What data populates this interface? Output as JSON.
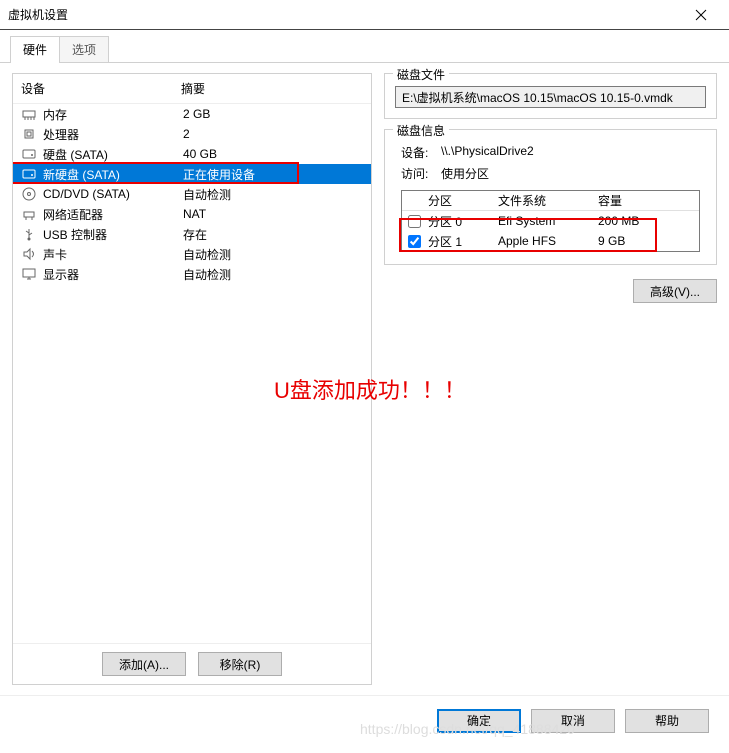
{
  "window": {
    "title": "虚拟机设置"
  },
  "tabs": {
    "hardware": "硬件",
    "options": "选项"
  },
  "device_table": {
    "header_device": "设备",
    "header_summary": "摘要"
  },
  "devices": [
    {
      "icon": "memory-icon",
      "name": "内存",
      "summary": "2 GB"
    },
    {
      "icon": "cpu-icon",
      "name": "处理器",
      "summary": "2"
    },
    {
      "icon": "disk-icon",
      "name": "硬盘 (SATA)",
      "summary": "40 GB"
    },
    {
      "icon": "disk-icon",
      "name": "新硬盘 (SATA)",
      "summary": "正在使用设备"
    },
    {
      "icon": "cd-icon",
      "name": "CD/DVD (SATA)",
      "summary": "自动检测"
    },
    {
      "icon": "network-icon",
      "name": "网络适配器",
      "summary": "NAT"
    },
    {
      "icon": "usb-icon",
      "name": "USB 控制器",
      "summary": "存在"
    },
    {
      "icon": "sound-icon",
      "name": "声卡",
      "summary": "自动检测"
    },
    {
      "icon": "display-icon",
      "name": "显示器",
      "summary": "自动检测"
    }
  ],
  "left_buttons": {
    "add": "添加(A)...",
    "remove": "移除(R)"
  },
  "disk_file": {
    "legend": "磁盘文件",
    "path": "E:\\虚拟机系统\\macOS 10.15\\macOS 10.15-0.vmdk"
  },
  "disk_info": {
    "legend": "磁盘信息",
    "device_label": "设备:",
    "device_value": "\\\\.\\PhysicalDrive2",
    "access_label": "访问:",
    "access_value": "使用分区",
    "headers": {
      "partition": "分区",
      "filesystem": "文件系统",
      "capacity": "容量"
    },
    "partitions": [
      {
        "checked": false,
        "name": "分区 0",
        "fs": "Efi System",
        "cap": "200 MB"
      },
      {
        "checked": true,
        "name": "分区 1",
        "fs": "Apple HFS",
        "cap": "9 GB"
      }
    ]
  },
  "advanced_button": "高级(V)...",
  "bottom_buttons": {
    "ok": "确定",
    "cancel": "取消",
    "help": "帮助"
  },
  "annotation": "U盘添加成功！！！",
  "watermark": "https://blog.csdn.net/qq_41888420"
}
